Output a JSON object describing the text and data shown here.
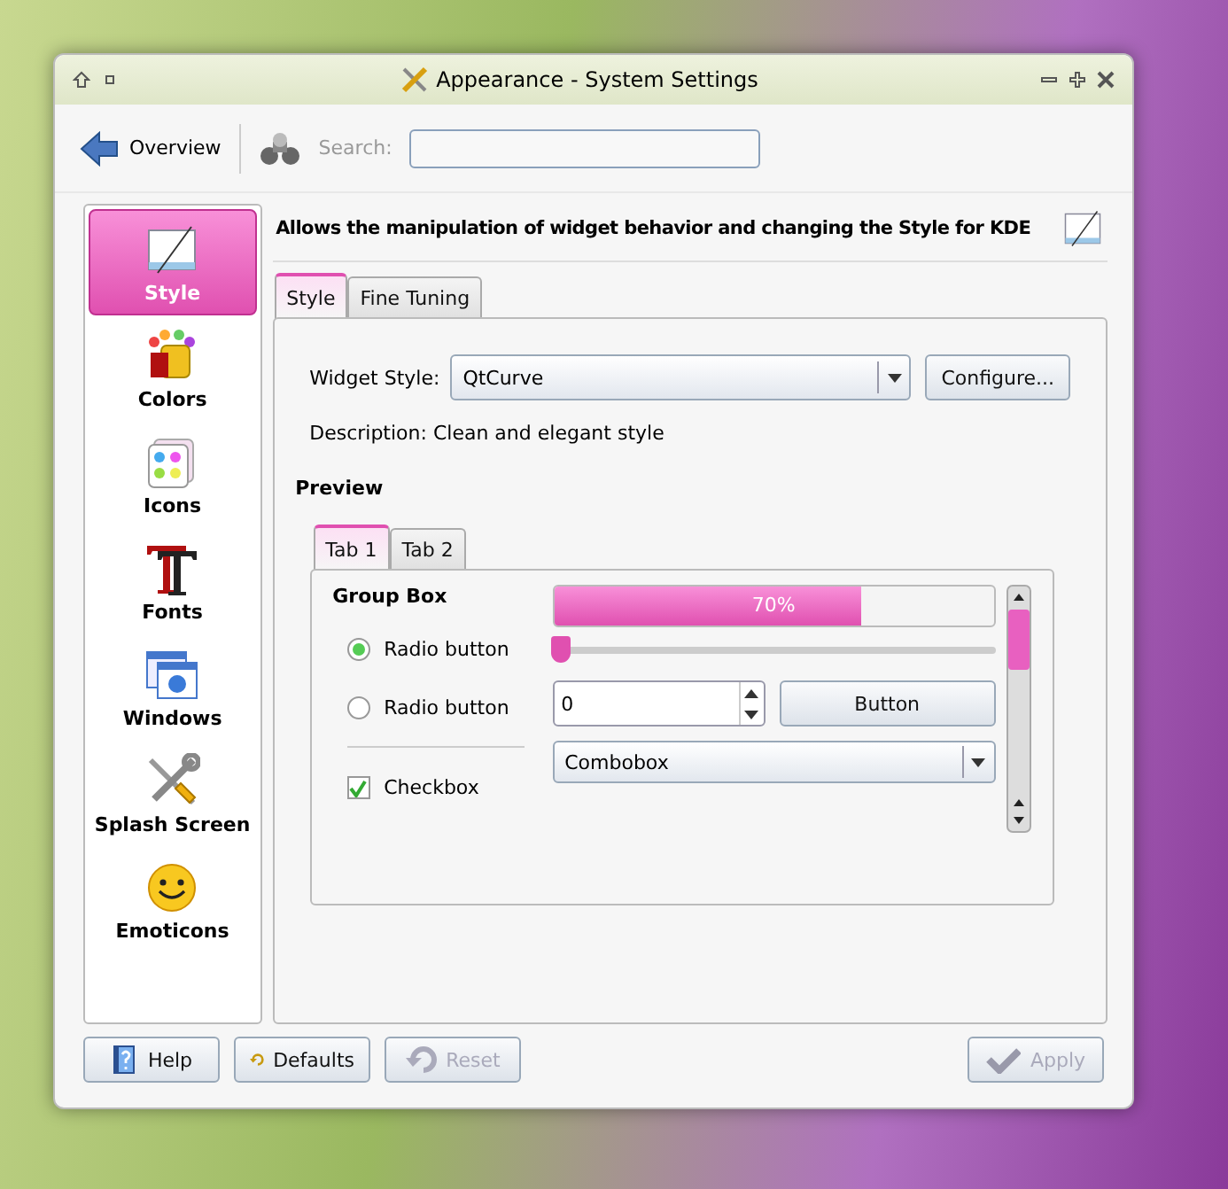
{
  "window": {
    "title": "Appearance - System Settings"
  },
  "toolbar": {
    "overview_button": "Overview",
    "search_label": "Search:"
  },
  "sidebar": {
    "items": [
      {
        "label": "Style",
        "kind": "style",
        "selected": true
      },
      {
        "label": "Colors",
        "kind": "colors",
        "selected": false
      },
      {
        "label": "Icons",
        "kind": "icons",
        "selected": false
      },
      {
        "label": "Fonts",
        "kind": "fonts",
        "selected": false
      },
      {
        "label": "Windows",
        "kind": "windows",
        "selected": false
      },
      {
        "label": "Splash Screen",
        "kind": "tools",
        "selected": false
      },
      {
        "label": "Emoticons",
        "kind": "smiley",
        "selected": false
      }
    ]
  },
  "header": "Allows the manipulation of widget behavior and changing the Style for KDE",
  "tabs": [
    {
      "label": "Style",
      "selected": true
    },
    {
      "label": "Fine Tuning",
      "selected": false
    }
  ],
  "widget_style": {
    "label": "Widget Style:",
    "value": "QtCurve",
    "configure_button": "Configure..."
  },
  "description": "Description: Clean and elegant style",
  "preview": {
    "heading": "Preview",
    "tabs": [
      {
        "label": "Tab 1",
        "selected": true
      },
      {
        "label": "Tab 2",
        "selected": false
      }
    ],
    "group_box": "Group Box",
    "radios": [
      {
        "label": "Radio button",
        "selected": true
      },
      {
        "label": "Radio button",
        "selected": false
      }
    ],
    "checkbox": {
      "label": "Checkbox",
      "checked": true
    },
    "progress": {
      "level": 0.7,
      "reading": "70%"
    },
    "slider": {
      "level": 0
    },
    "spinbox": {
      "value": "0"
    },
    "button": "Button",
    "combobox": {
      "value": "Combobox"
    }
  },
  "buttons": [
    {
      "label": "Help",
      "kind": "help",
      "disabled": false
    },
    {
      "label": "Defaults",
      "kind": "defaults",
      "disabled": false
    },
    {
      "label": "Reset",
      "kind": "reset",
      "disabled": true
    },
    {
      "label": "Apply",
      "kind": "apply",
      "disabled": true
    }
  ]
}
